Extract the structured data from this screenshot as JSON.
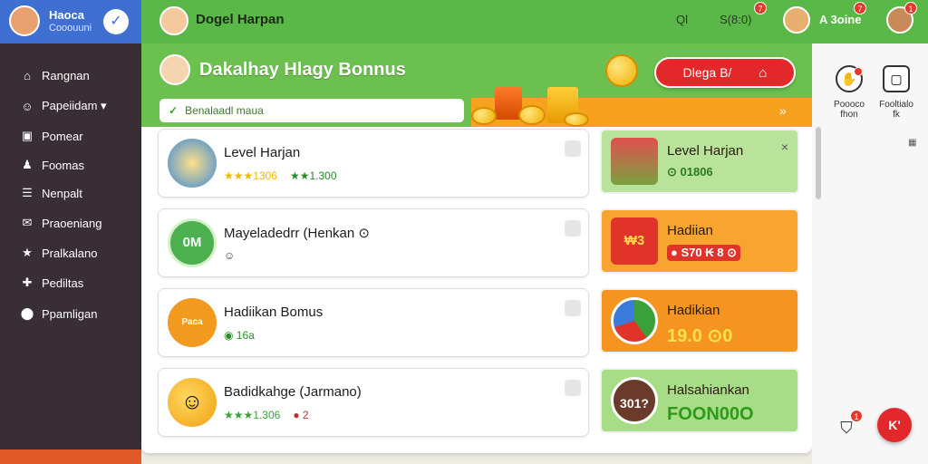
{
  "sidebar": {
    "user_name": "Haoca",
    "user_sub": "Cooouuni",
    "items": [
      {
        "icon": "home-icon",
        "glyph": "⌂",
        "label": "Rangnan"
      },
      {
        "icon": "user-icon",
        "glyph": "☺",
        "label": "Papeiidam ▾"
      },
      {
        "icon": "book-icon",
        "glyph": "▣",
        "label": "Pomear"
      },
      {
        "icon": "person-icon",
        "glyph": "♟",
        "label": "Foomas"
      },
      {
        "icon": "list-icon",
        "glyph": "☰",
        "label": "Nenpalt"
      },
      {
        "icon": "mail-icon",
        "glyph": "✉",
        "label": "Praoeniang"
      },
      {
        "icon": "star-icon",
        "glyph": "★",
        "label": "Pralkalano"
      },
      {
        "icon": "plus-icon",
        "glyph": "✚",
        "label": "Pediltas"
      },
      {
        "icon": "location-icon",
        "glyph": "⬤",
        "label": "Ppamligan"
      }
    ]
  },
  "header": {
    "title": "Dogel Harpan",
    "q_label": "Ql",
    "score_text": "S(8:0)",
    "score_badge": "7",
    "user_text": "A 3oine",
    "user_badge": "7",
    "profile_badge": "1"
  },
  "banner": {
    "title": "Dakalhay Hlagy Bonnus",
    "search_placeholder": "Benalaadl maua",
    "button_label": "Dlega B/",
    "lock_glyph": "🔒"
  },
  "cards": [
    {
      "title": "Level Harjan",
      "meta1": "★★★1306",
      "meta2": "★★1.300"
    },
    {
      "title": "Mayeladedrr (Henkan ⊙",
      "thumb_text": "0M",
      "meta1": "☺"
    },
    {
      "title": "Hadiikan Bomus",
      "thumb_text": "Paca",
      "meta1": "◉ 16a"
    },
    {
      "title": "Badidkahge (Jarmano)",
      "meta1": "★★★1.306",
      "meta2": "● 2"
    }
  ],
  "rcards": [
    {
      "title": "Level Harjan",
      "value": "⊙ 01806",
      "close": "×"
    },
    {
      "title": "Hadiian",
      "value": "● S70 ₭ 8 ⊙",
      "thumb_text": "₩3"
    },
    {
      "title": "Hadikian",
      "value": "19.0 ⊙0"
    },
    {
      "title": "Halsahiankan",
      "value": "FOON00O",
      "thumb_text": "301?"
    }
  ],
  "rail": {
    "item1_label": "Poooco\nfhon",
    "item2_label": "Fooltialo\nfk",
    "cart_badge": "1",
    "fab_label": "K'"
  },
  "colors": {
    "sidebar": "#3a2e36",
    "sidebar_top": "#3f6fd0",
    "header": "#5ab848",
    "accent_red": "#e2282a",
    "accent_orange": "#f6a21e"
  }
}
